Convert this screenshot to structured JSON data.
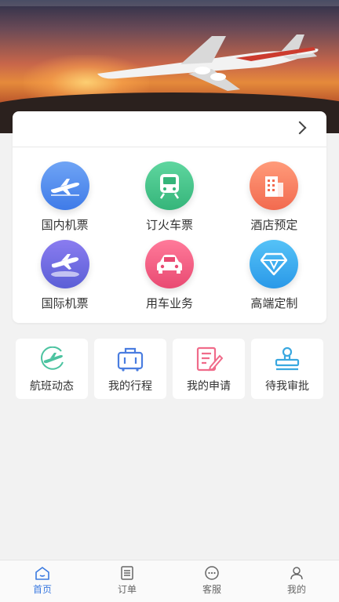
{
  "services": [
    {
      "label": "国内机票",
      "icon": "domestic-flight-icon",
      "color_from": "#6fa4f5",
      "color_to": "#3f7be8"
    },
    {
      "label": "订火车票",
      "icon": "train-icon",
      "color_from": "#5fd69f",
      "color_to": "#35b57a"
    },
    {
      "label": "酒店预定",
      "icon": "hotel-icon",
      "color_from": "#ff9b7a",
      "color_to": "#f26a4f"
    },
    {
      "label": "国际机票",
      "icon": "international-flight-icon",
      "color_from": "#8a7cf0",
      "color_to": "#5b5fd6"
    },
    {
      "label": "用车业务",
      "icon": "car-icon",
      "color_from": "#ff7a9a",
      "color_to": "#e94a72"
    },
    {
      "label": "高端定制",
      "icon": "diamond-icon",
      "color_from": "#55c2f7",
      "color_to": "#2a99e8"
    }
  ],
  "quick": [
    {
      "label": "航班动态",
      "icon": "flight-status-icon",
      "color": "#4cc3a0"
    },
    {
      "label": "我的行程",
      "icon": "luggage-icon",
      "color": "#4a7de0"
    },
    {
      "label": "我的申请",
      "icon": "application-edit-icon",
      "color": "#f06b8a"
    },
    {
      "label": "待我审批",
      "icon": "stamp-icon",
      "color": "#3aa8e0"
    }
  ],
  "tabs": [
    {
      "label": "首页",
      "icon": "home-icon",
      "active": true
    },
    {
      "label": "订单",
      "icon": "order-list-icon",
      "active": false
    },
    {
      "label": "客服",
      "icon": "customer-service-icon",
      "active": false
    },
    {
      "label": "我的",
      "icon": "profile-icon",
      "active": false
    }
  ],
  "colors": {
    "accent": "#3b7ae0",
    "tab_inactive": "#666666",
    "background": "#f2f2f2"
  }
}
